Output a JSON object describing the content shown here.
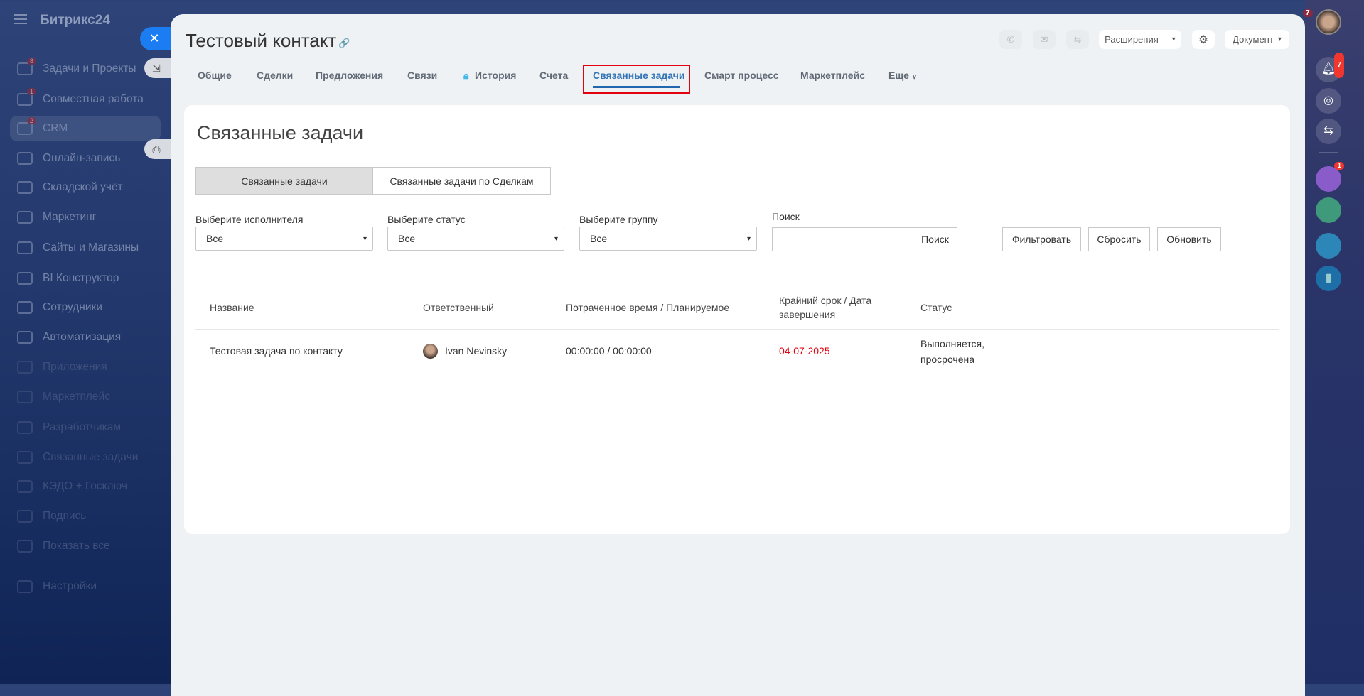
{
  "sidebar": {
    "logo": "Битрикс24",
    "items": [
      {
        "label": "Задачи и Проекты",
        "badge": "8"
      },
      {
        "label": "Совместная работа",
        "badge": "1"
      },
      {
        "label": "CRM",
        "badge": "2"
      },
      {
        "label": "Онлайн-запись"
      },
      {
        "label": "Складской учёт"
      },
      {
        "label": "Маркетинг"
      },
      {
        "label": "Сайты и Магазины"
      },
      {
        "label": "BI Конструктор"
      },
      {
        "label": "Сотрудники"
      },
      {
        "label": "Автоматизация"
      },
      {
        "label": "Приложения"
      },
      {
        "label": "Маркетплейс"
      },
      {
        "label": "Разработчикам"
      },
      {
        "label": "Связанные задачи"
      },
      {
        "label": "КЭДО + Госключ"
      },
      {
        "label": "Подпись"
      },
      {
        "label": "Показать все"
      },
      {
        "label": "Настройки"
      }
    ]
  },
  "header": {
    "title": "Тестовый контакт",
    "extensions": "Расширения",
    "document": "Документ"
  },
  "tabs": [
    "Общие",
    "Сделки",
    "Предложения",
    "Связи",
    "История",
    "Счета",
    "Связанные задачи",
    "Смарт процесс",
    "Маркетплейс",
    "Еще"
  ],
  "main": {
    "heading": "Связанные задачи",
    "toggle": [
      "Связанные задачи",
      "Связанные задачи по Сделкам"
    ],
    "filters": {
      "executor_label": "Выберите исполнителя",
      "executor_value": "Все",
      "status_label": "Выберите статус",
      "status_value": "Все",
      "group_label": "Выберите группу",
      "group_value": "Все",
      "search_label": "Поиск",
      "search_value": "",
      "search_button": "Поиск"
    },
    "buttons": {
      "filter": "Фильтровать",
      "reset": "Сбросить",
      "refresh": "Обновить"
    },
    "table": {
      "headers": [
        "Название",
        "Ответственный",
        "Потраченное время / Планируемое",
        "Крайний срок / Дата завершения",
        "Статус"
      ],
      "rows": [
        {
          "name": "Тестовая задача по контакту",
          "responsible": "Ivan Nevinsky",
          "time": "00:00:00 / 00:00:00",
          "deadline": "04-07-2025",
          "status": "Выполняется, просрочена"
        }
      ]
    }
  },
  "rail": {
    "notifications_badge": "7",
    "avatar_badge": "7",
    "promo_badge": "1"
  },
  "colors": {
    "accent": "#2067b0",
    "overdue": "#e3000f",
    "close": "#1c7cf2"
  }
}
